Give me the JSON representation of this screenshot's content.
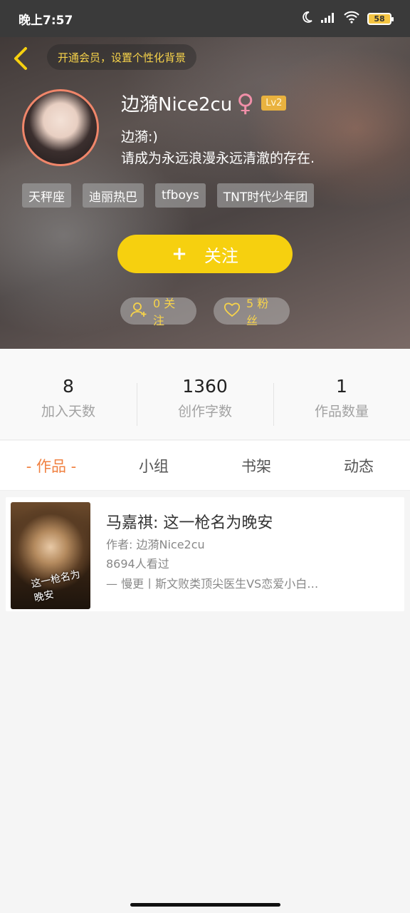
{
  "status_bar": {
    "time": "晚上7:57",
    "battery": "58"
  },
  "header": {
    "vip_prompt": "开通会员，设置个性化背景"
  },
  "profile": {
    "nickname": "边漪Nice2cu",
    "gender_symbol": "♀",
    "level": "Lv2",
    "bio_line1": "边漪:)",
    "bio_line2": "请成为永远浪漫永远清澈的存在.",
    "tags": [
      "天秤座",
      "迪丽热巴",
      "tfboys",
      "TNT时代少年团"
    ],
    "follow_label": "关注",
    "following_text": "0 关注",
    "fans_text": "5 粉丝"
  },
  "stats": [
    {
      "value": "8",
      "label": "加入天数"
    },
    {
      "value": "1360",
      "label": "创作字数"
    },
    {
      "value": "1",
      "label": "作品数量"
    }
  ],
  "tabs": [
    "- 作品 -",
    "小组",
    "书架",
    "动态"
  ],
  "works": [
    {
      "title": "马嘉祺: 这一枪名为晚安",
      "author": "作者: 边漪Nice2cu",
      "views": "8694人看过",
      "description": "— 慢更丨斯文败类顶尖医生VS恋爱小白…",
      "cover_text": "这一枪名为晚安"
    }
  ],
  "colors": {
    "accent": "#f08040",
    "follow_button": "#f6d00f",
    "vip_text": "#f7d34a"
  }
}
